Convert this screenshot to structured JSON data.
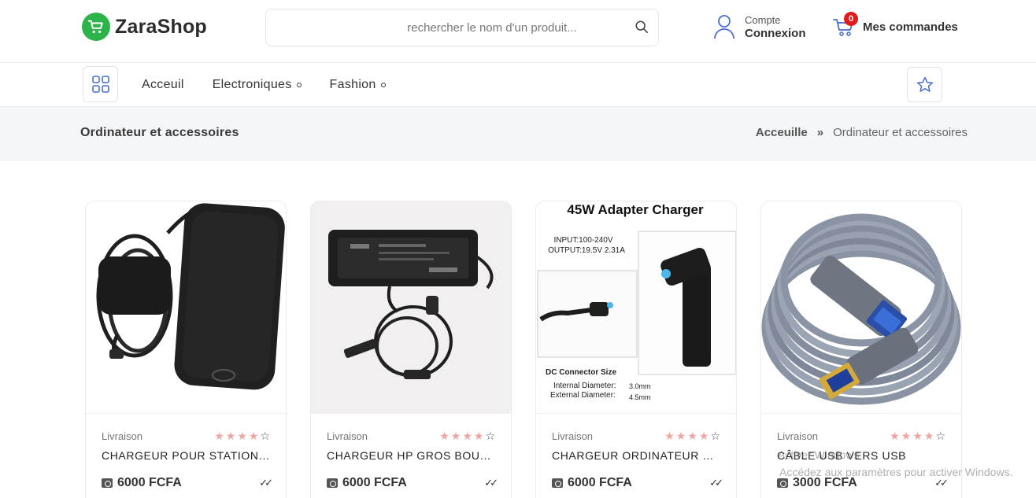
{
  "header": {
    "brand": "ZaraShop",
    "search_placeholder": "rechercher le nom d'un produit...",
    "account_sub": "Compte",
    "account_main": "Connexion",
    "orders_label": "Mes commandes",
    "orders_count": "0"
  },
  "nav": {
    "items": [
      {
        "label": "Acceuil",
        "has_submenu": false
      },
      {
        "label": "Electroniques",
        "has_submenu": true
      },
      {
        "label": "Fashion",
        "has_submenu": true
      }
    ]
  },
  "page": {
    "title": "Ordinateur et accessoires",
    "breadcrumb_home": "Acceuille",
    "breadcrumb_sep": "»",
    "breadcrumb_current": "Ordinateur et accessoires"
  },
  "products": [
    {
      "delivery": "Livraison",
      "rating": 4,
      "name": "CHARGEUR POUR STATION…",
      "price": "6000 FCFA"
    },
    {
      "delivery": "Livraison",
      "rating": 4,
      "name": "CHARGEUR HP GROS BOUT…",
      "price": "6000 FCFA"
    },
    {
      "delivery": "Livraison",
      "rating": 4,
      "name": "CHARGEUR ORDINATEUR P…",
      "price": "6000 FCFA",
      "image_text": {
        "title": "45W Adapter Charger",
        "input": "INPUT:100-240V",
        "output": "OUTPUT:19.5V 2.31A",
        "dc": "DC Connector Size",
        "internal": "Internal Diameter:",
        "internal_val": "3.0mm",
        "external": "External Diameter:",
        "external_val": "4.5mm"
      }
    },
    {
      "delivery": "Livraison",
      "rating": 4,
      "name": "CÂBLE USB VERS USB",
      "price": "3000 FCFA"
    }
  ],
  "watermark": {
    "line1": "Activer Windows",
    "line2": "Accédez aux paramètres pour activer Windows."
  },
  "colors": {
    "brand_green": "#2cb34a",
    "badge_red": "#e01b1b",
    "star_pink": "#f0a5a0",
    "icon_blue": "#4a6fd0"
  }
}
